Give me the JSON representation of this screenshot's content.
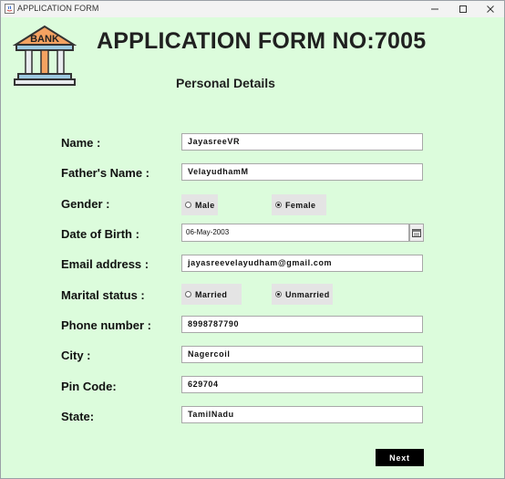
{
  "window": {
    "title": "APPLICATION FORM",
    "controls": [
      "minimize",
      "maximize",
      "close"
    ]
  },
  "header": {
    "logo_text": "BANK",
    "title": "APPLICATION FORM NO:7005",
    "subtitle": "Personal Details"
  },
  "form": {
    "name": {
      "label": "Name :",
      "value": "JayasreeVR"
    },
    "father_name": {
      "label": "Father's Name :",
      "value": "VelayudhamM"
    },
    "gender": {
      "label": "Gender :",
      "options": [
        "Male",
        "Female"
      ],
      "selected": "Female"
    },
    "dob": {
      "label": "Date of Birth :",
      "value": "06-May-2003"
    },
    "email": {
      "label": "Email address :",
      "value": "jayasreevelayudham@gmail.com"
    },
    "marital_status": {
      "label": "Marital status :",
      "options": [
        "Married",
        "Unmarried"
      ],
      "selected": "Unmarried"
    },
    "phone": {
      "label": "Phone number :",
      "value": "8998787790"
    },
    "city": {
      "label": "City :",
      "value": "Nagercoil"
    },
    "pin_code": {
      "label": "Pin Code:",
      "value": "629704"
    },
    "state": {
      "label": "State:",
      "value": "TamilNadu"
    }
  },
  "actions": {
    "next_label": "Next"
  },
  "colors": {
    "background": "#dcfcdc",
    "button": "#000000",
    "button_text": "#ffffff"
  }
}
